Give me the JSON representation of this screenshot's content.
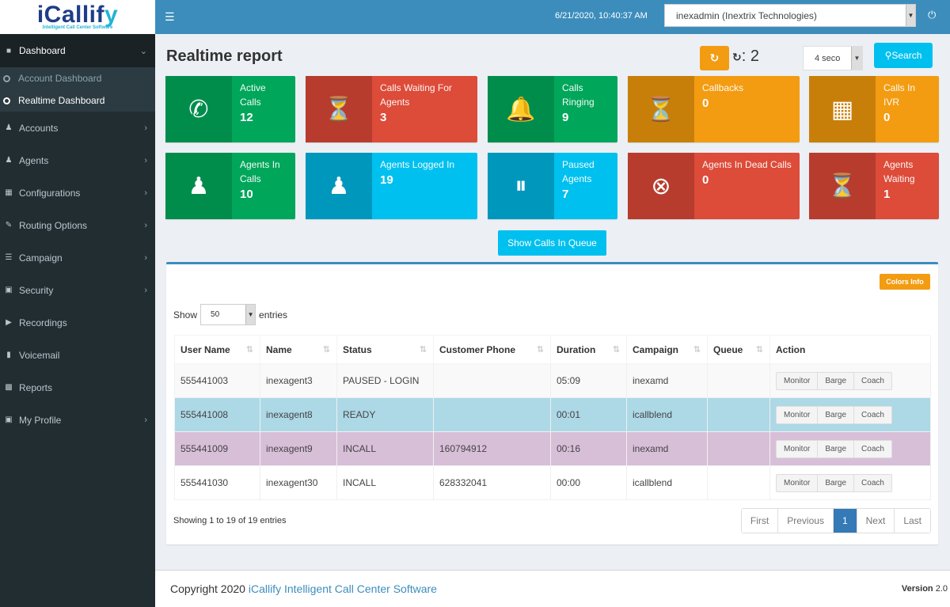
{
  "brand": {
    "logo_prefix": "iCallif",
    "logo_suffix": "y",
    "tagline": "Intelligent Call Center Software"
  },
  "header": {
    "datetime": "6/21/2020, 10:40:37 AM",
    "account": "inexadmin (Inextrix Technologies)"
  },
  "sidebar": {
    "items": [
      {
        "label": "Dashboard",
        "icon": "dashboard-icon",
        "arrow": "⌄"
      },
      {
        "label": "Accounts",
        "icon": "users-icon",
        "arrow": "›"
      },
      {
        "label": "Agents",
        "icon": "users-icon",
        "arrow": "›"
      },
      {
        "label": "Configurations",
        "icon": "table-icon",
        "arrow": "›"
      },
      {
        "label": "Routing Options",
        "icon": "edit-icon",
        "arrow": "›"
      },
      {
        "label": "Campaign",
        "icon": "list-icon",
        "arrow": "›"
      },
      {
        "label": "Security",
        "icon": "lock-icon",
        "arrow": "›"
      },
      {
        "label": "Recordings",
        "icon": "play-icon",
        "arrow": ""
      },
      {
        "label": "Voicemail",
        "icon": "microphone-icon",
        "arrow": ""
      },
      {
        "label": "Reports",
        "icon": "calendar-icon",
        "arrow": ""
      },
      {
        "label": "My Profile",
        "icon": "lock-icon",
        "arrow": "›"
      }
    ],
    "sub_items": [
      {
        "label": "Account Dashboard"
      },
      {
        "label": "Realtime Dashboard",
        "active": true
      }
    ]
  },
  "page": {
    "title": "Realtime report",
    "refresh_count": "2",
    "interval": "4 seco",
    "search_label": "Search",
    "queue_button": "Show Calls In Queue"
  },
  "stats": [
    {
      "label1": "Active",
      "label2": "Calls",
      "value": "12",
      "color": "green",
      "icon": "phone-icon"
    },
    {
      "label1": "Calls Waiting For",
      "label2": "Agents",
      "value": "3",
      "color": "red",
      "icon": "phone-clock-icon"
    },
    {
      "label1": "Calls",
      "label2": "Ringing",
      "value": "9",
      "color": "green",
      "icon": "bell-ringing-icon"
    },
    {
      "label1": "Callbacks",
      "label2": "",
      "value": "0",
      "color": "orange",
      "icon": "callback-icon"
    },
    {
      "label1": "Calls In",
      "label2": "IVR",
      "value": "0",
      "color": "orange",
      "icon": "ivr-keypad-icon"
    },
    {
      "label1": "Agents In",
      "label2": "Calls",
      "value": "10",
      "color": "green",
      "icon": "headset-agents-icon"
    },
    {
      "label1": "Agents Logged In",
      "label2": "",
      "value": "19",
      "color": "aqua",
      "icon": "group-icon"
    },
    {
      "label1": "Paused",
      "label2": "Agents",
      "value": "7",
      "color": "aqua",
      "icon": "agent-paused-icon"
    },
    {
      "label1": "Agents In Dead Calls",
      "label2": "",
      "value": "0",
      "color": "red",
      "icon": "agent-dead-call-icon"
    },
    {
      "label1": "Agents",
      "label2": "Waiting",
      "value": "1",
      "color": "red",
      "icon": "agent-waiting-icon"
    }
  ],
  "table": {
    "colors_info": "Colors Info",
    "show_label": "Show",
    "entries_label": "entries",
    "page_length": "50",
    "columns": [
      "User Name",
      "Name",
      "Status",
      "Customer Phone",
      "Duration",
      "Campaign",
      "Queue",
      "Action"
    ],
    "rows": [
      {
        "user": "555441003",
        "name": "inexagent3",
        "status": "PAUSED - LOGIN",
        "phone": "",
        "duration": "05:09",
        "campaign": "inexamd",
        "queue": ""
      },
      {
        "user": "555441008",
        "name": "inexagent8",
        "status": "READY",
        "phone": "",
        "duration": "00:01",
        "campaign": "icallblend",
        "queue": ""
      },
      {
        "user": "555441009",
        "name": "inexagent9",
        "status": "INCALL",
        "phone": "160794912",
        "duration": "00:16",
        "campaign": "inexamd",
        "queue": ""
      },
      {
        "user": "555441030",
        "name": "inexagent30",
        "status": "INCALL",
        "phone": "628332041",
        "duration": "00:00",
        "campaign": "icallblend",
        "queue": ""
      }
    ],
    "actions": [
      "Monitor",
      "Barge",
      "Coach"
    ],
    "info": "Showing 1 to 19 of 19 entries",
    "pagination": [
      "First",
      "Previous",
      "1",
      "Next",
      "Last"
    ],
    "current_page": "1"
  },
  "footer": {
    "copyright_prefix": "Copyright 2020 ",
    "copyright_brand": "iCallify Intelligent Call Center Software",
    "version_label": "Version",
    "version": "2.0"
  }
}
